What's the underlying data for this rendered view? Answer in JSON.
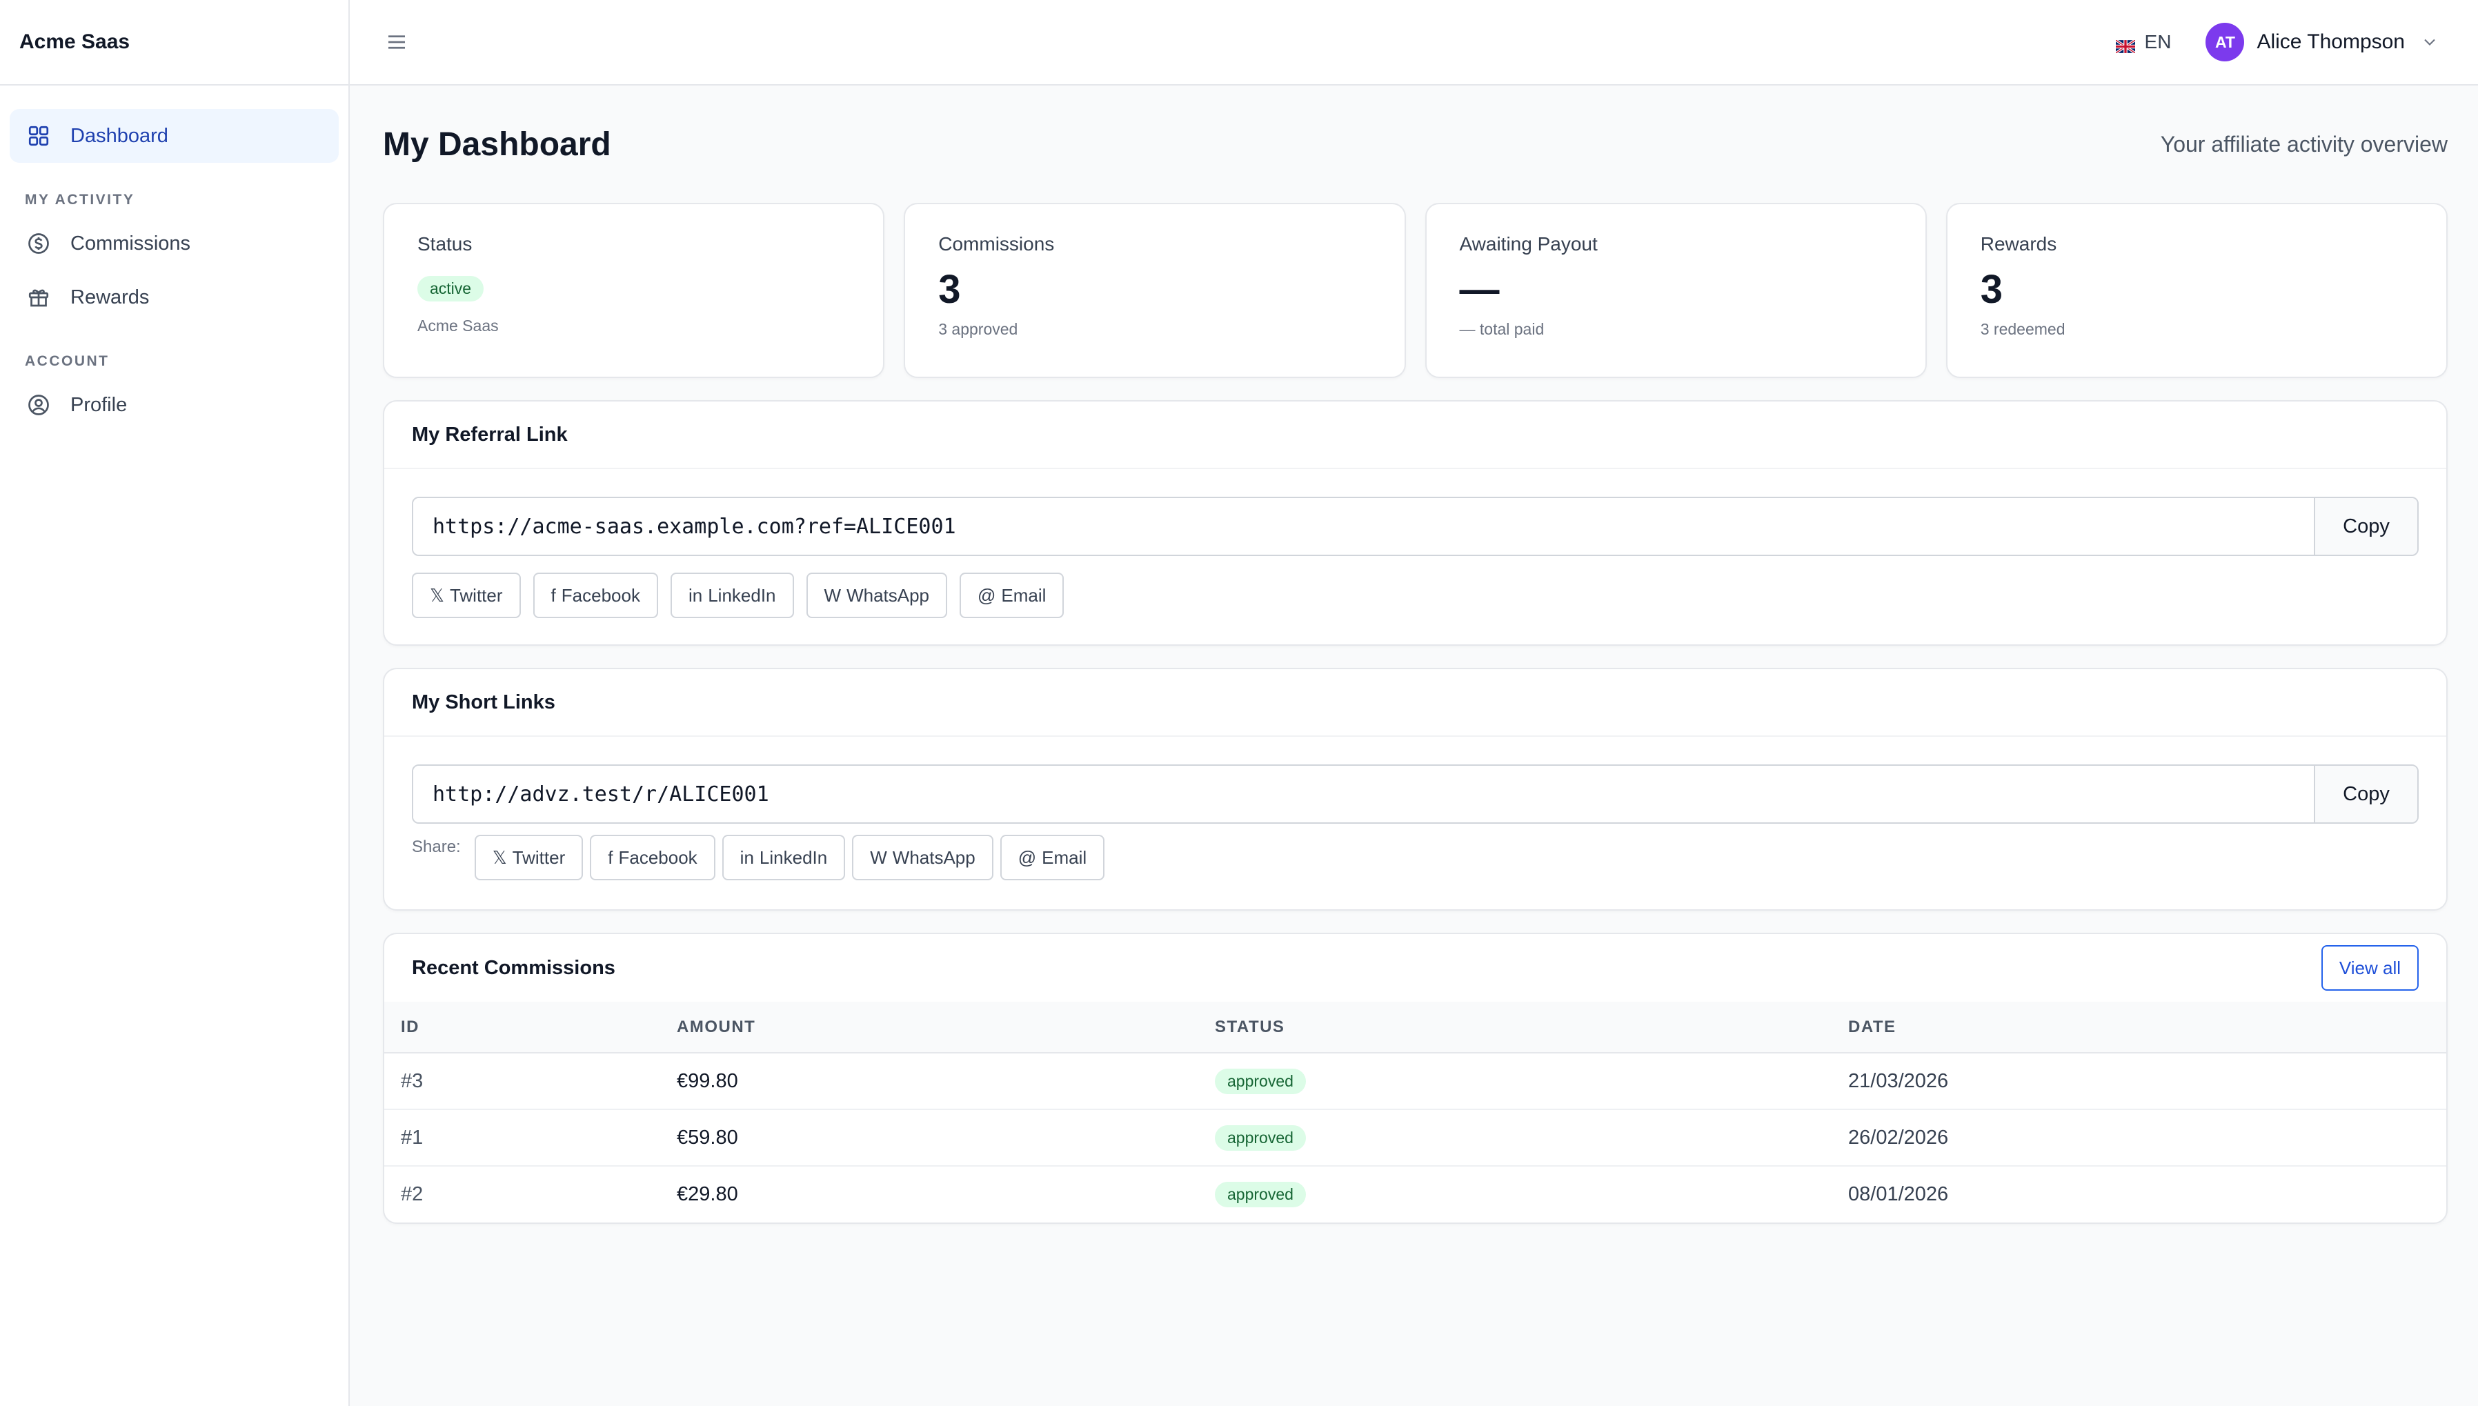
{
  "app": {
    "brand": "Acme Saas"
  },
  "sidebar": {
    "items": [
      {
        "label": "Dashboard",
        "icon": "grid-icon",
        "active": true
      }
    ],
    "sections": [
      {
        "title": "MY ACTIVITY",
        "items": [
          {
            "label": "Commissions",
            "icon": "dollar-circle-icon"
          },
          {
            "label": "Rewards",
            "icon": "gift-icon"
          }
        ]
      },
      {
        "title": "ACCOUNT",
        "items": [
          {
            "label": "Profile",
            "icon": "user-circle-icon"
          }
        ]
      }
    ]
  },
  "topbar": {
    "language": "EN",
    "language_flag": "uk-flag-icon",
    "user": {
      "initials": "AT",
      "name": "Alice Thompson"
    }
  },
  "page": {
    "title": "My Dashboard",
    "subtitle": "Your affiliate activity overview"
  },
  "stats": [
    {
      "label": "Status",
      "badge": "active",
      "note": "Acme Saas"
    },
    {
      "label": "Commissions",
      "value": "3",
      "note": "3 approved"
    },
    {
      "label": "Awaiting Payout",
      "value": "—",
      "note": "— total paid"
    },
    {
      "label": "Rewards",
      "value": "3",
      "note": "3 redeemed"
    }
  ],
  "referral": {
    "title": "My Referral Link",
    "url": "https://acme-saas.example.com?ref=ALICE001",
    "copy_label": "Copy",
    "share": [
      {
        "glyph": "𝕏",
        "label": "Twitter"
      },
      {
        "glyph": "f",
        "label": "Facebook"
      },
      {
        "glyph": "in",
        "label": "LinkedIn"
      },
      {
        "glyph": "W",
        "label": "WhatsApp"
      },
      {
        "glyph": "@",
        "label": "Email"
      }
    ]
  },
  "short_links": {
    "title": "My Short Links",
    "url": "http://advz.test/r/ALICE001",
    "copy_label": "Copy",
    "share_label": "Share:",
    "share": [
      {
        "glyph": "𝕏",
        "label": "Twitter"
      },
      {
        "glyph": "f",
        "label": "Facebook"
      },
      {
        "glyph": "in",
        "label": "LinkedIn"
      },
      {
        "glyph": "W",
        "label": "WhatsApp"
      },
      {
        "glyph": "@",
        "label": "Email"
      }
    ]
  },
  "commissions": {
    "title": "Recent Commissions",
    "view_all": "View all",
    "columns": [
      "ID",
      "AMOUNT",
      "STATUS",
      "DATE"
    ],
    "rows": [
      {
        "id": "#3",
        "amount": "€99.80",
        "status": "approved",
        "date": "21/03/2026"
      },
      {
        "id": "#1",
        "amount": "€59.80",
        "status": "approved",
        "date": "26/02/2026"
      },
      {
        "id": "#2",
        "amount": "€29.80",
        "status": "approved",
        "date": "08/01/2026"
      }
    ]
  },
  "colors": {
    "accent": "#2563eb",
    "active_nav_bg": "#eff6ff",
    "avatar": "#7c3aed",
    "success_bg": "#dcfce7",
    "success_text": "#166534"
  }
}
